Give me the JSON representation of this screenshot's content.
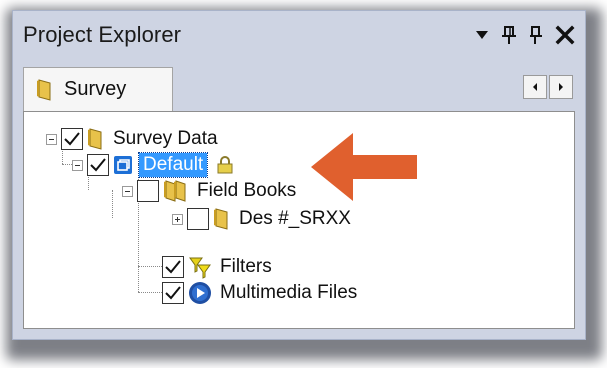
{
  "panel": {
    "title": "Project Explorer",
    "controls": [
      "dropdown-icon",
      "pin-icon",
      "autohide-icon",
      "close-icon"
    ]
  },
  "tabs": [
    {
      "label": "Survey",
      "icon": "folder-icon",
      "active": true
    }
  ],
  "tree": {
    "nodes": [
      {
        "label": "Survey Data",
        "checked": true,
        "expanded": true,
        "icon": "folder-icon"
      },
      {
        "label": "Default",
        "checked": true,
        "expanded": true,
        "icon": "window-icon",
        "selected": true,
        "locked": true
      },
      {
        "label": "Field Books",
        "checked": false,
        "expanded": true,
        "icon": "folders-icon"
      },
      {
        "label": "Des #_SRXX",
        "checked": false,
        "expanded": false,
        "icon": "folder-icon"
      },
      {
        "label": "Filters",
        "checked": true,
        "icon": "filter-icon"
      },
      {
        "label": "Multimedia Files",
        "checked": true,
        "icon": "media-icon"
      }
    ]
  },
  "colors": {
    "panel_bg": "#ced4e3",
    "selection": "#3399ff",
    "arrow": "#e0602e",
    "folder": "#e8c24a"
  }
}
